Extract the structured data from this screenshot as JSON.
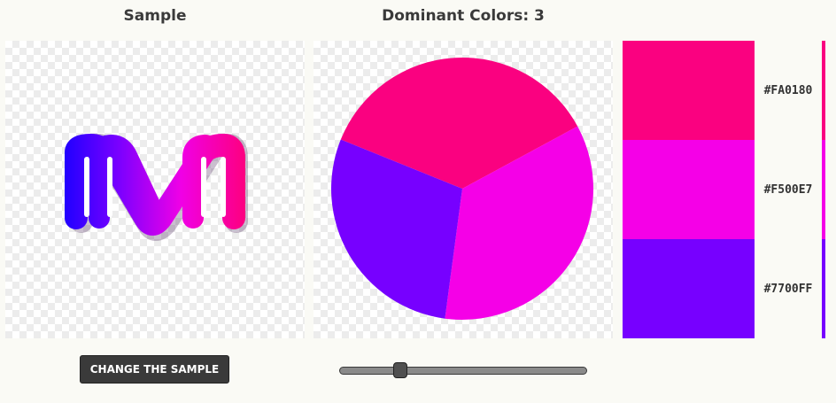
{
  "headings": {
    "sample": "Sample",
    "dominant": "Dominant Colors: 3"
  },
  "sample_logo": {
    "icon": "m-loop-logo-icon",
    "gradient": [
      "#1a00ff",
      "#7a00ff",
      "#f000e6",
      "#ff0070"
    ]
  },
  "dominant_colors": [
    {
      "hex_label": "#FA0180",
      "color": "#FA0180",
      "share": 0.36
    },
    {
      "hex_label": "#F500E7",
      "color": "#F500E7",
      "share": 0.35
    },
    {
      "hex_label": "#7700FF",
      "color": "#7700FF",
      "share": 0.29
    }
  ],
  "controls": {
    "change_sample_label": "CHANGE THE SAMPLE",
    "color_count": {
      "min": 1,
      "max": 10,
      "value": 3
    }
  }
}
